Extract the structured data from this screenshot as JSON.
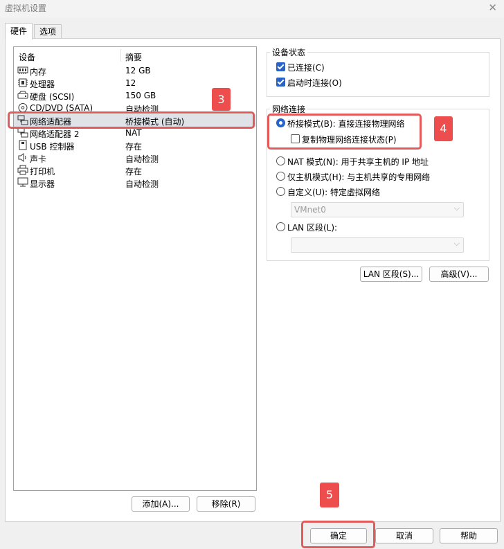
{
  "window": {
    "title": "虚拟机设置"
  },
  "tabs": [
    {
      "label": "硬件"
    },
    {
      "label": "选项"
    }
  ],
  "devices": {
    "col_device": "设备",
    "col_summary": "摘要",
    "items": [
      {
        "name": "内存",
        "summary": "12 GB",
        "icon": "memory-icon"
      },
      {
        "name": "处理器",
        "summary": "12",
        "icon": "processor-icon"
      },
      {
        "name": "硬盘 (SCSI)",
        "summary": "150 GB",
        "icon": "hard-disk-icon"
      },
      {
        "name": "CD/DVD (SATA)",
        "summary": "自动检测",
        "icon": "cd-dvd-icon"
      },
      {
        "name": "网络适配器",
        "summary": "桥接模式 (自动)",
        "icon": "network-adapter-icon",
        "selected": true
      },
      {
        "name": "网络适配器 2",
        "summary": "NAT",
        "icon": "network-adapter-icon"
      },
      {
        "name": "USB 控制器",
        "summary": "存在",
        "icon": "usb-controller-icon"
      },
      {
        "name": "声卡",
        "summary": "自动检测",
        "icon": "sound-card-icon"
      },
      {
        "name": "打印机",
        "summary": "存在",
        "icon": "printer-icon"
      },
      {
        "name": "显示器",
        "summary": "自动检测",
        "icon": "display-icon"
      }
    ],
    "add_button": "添加(A)...",
    "remove_button": "移除(R)"
  },
  "device_status": {
    "title": "设备状态",
    "connected": {
      "label": "已连接(C)",
      "checked": true
    },
    "connect_at_power_on": {
      "label": "启动时连接(O)",
      "checked": true
    }
  },
  "network_connection": {
    "title": "网络连接",
    "bridged": {
      "label": "桥接模式(B): 直接连接物理网络",
      "selected": true
    },
    "replicate": {
      "label": "复制物理网络连接状态(P)",
      "checked": false
    },
    "nat": {
      "label": "NAT 模式(N): 用于共享主机的 IP 地址",
      "selected": false
    },
    "host_only": {
      "label": "仅主机模式(H): 与主机共享的专用网络",
      "selected": false
    },
    "custom": {
      "label": "自定义(U): 特定虚拟网络",
      "selected": false
    },
    "custom_select_value": "VMnet0",
    "lan_segment": {
      "label": "LAN 区段(L):",
      "selected": false
    },
    "lan_select_value": ""
  },
  "buttons": {
    "lan_segments": "LAN 区段(S)...",
    "advanced": "高级(V)...",
    "ok": "确定",
    "cancel": "取消",
    "help": "帮助"
  },
  "annotations": {
    "step3": "3",
    "step4": "4",
    "step5": "5"
  },
  "colors": {
    "highlight_red": "#e25a5a",
    "badge_red": "#ee4d4d",
    "accent_blue": "#2a63c8"
  }
}
